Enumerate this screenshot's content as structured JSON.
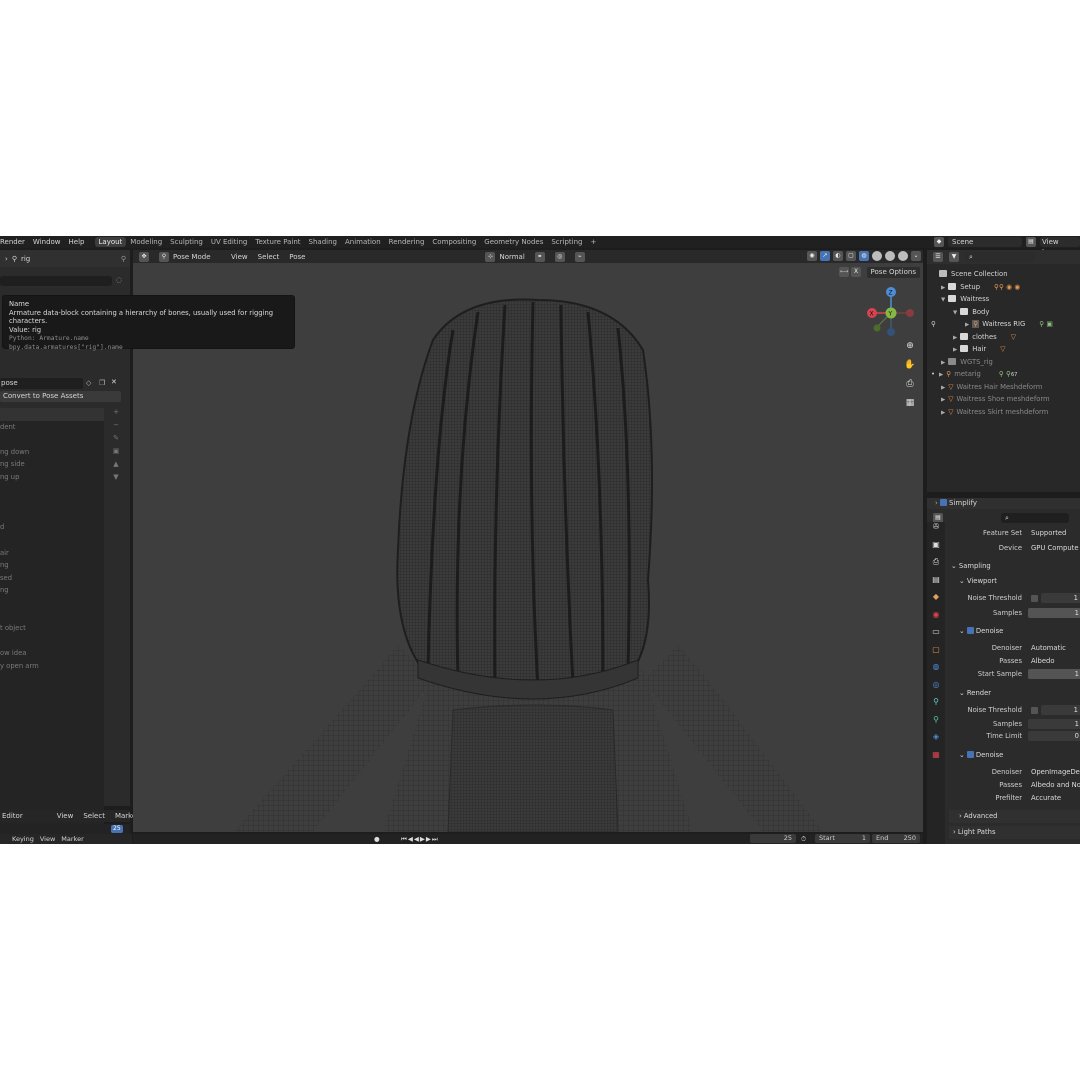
{
  "topbar": {
    "menus": [
      "Render",
      "Window",
      "Help"
    ],
    "workspaces": [
      {
        "label": "Layout",
        "active": true
      },
      {
        "label": "Modeling"
      },
      {
        "label": "Sculpting"
      },
      {
        "label": "UV Editing"
      },
      {
        "label": "Texture Paint"
      },
      {
        "label": "Shading"
      },
      {
        "label": "Animation"
      },
      {
        "label": "Rendering"
      },
      {
        "label": "Compositing"
      },
      {
        "label": "Geometry Nodes"
      },
      {
        "label": "Scripting"
      }
    ],
    "add_tab": "+",
    "scene": "Scene",
    "view_layer": "View Layer"
  },
  "left_panel": {
    "header_name": "rig",
    "pose_field": "pose",
    "convert_button": "Convert to Pose Assets",
    "list_items": [
      "",
      "dent",
      "",
      "ng down",
      "ng side",
      "ng up",
      "",
      "",
      "",
      "d",
      "",
      "air",
      "ng",
      "sed",
      "ng",
      "",
      "",
      "t object",
      "",
      "ow idea",
      "y open arm"
    ]
  },
  "tooltip": {
    "title": "Name",
    "description": "Armature data-block containing a hierarchy of bones, usually used for rigging characters.",
    "value": "Value: rig",
    "python1": "Python: Armature.name",
    "python2": "bpy.data.armatures[\"rig\"].name"
  },
  "timeline": {
    "editor_label": "Editor",
    "view": "View",
    "select": "Select",
    "marker": "Marker",
    "keying": "Keying",
    "view2": "View",
    "marker2": "Marker",
    "frame_badge": "25"
  },
  "viewport": {
    "mode": "Pose Mode",
    "menus": [
      "View",
      "Select",
      "Pose"
    ],
    "transform": "Normal",
    "pose_options": "Pose Options",
    "gizmo": {
      "z": "Z",
      "x": "X",
      "y": "Y"
    }
  },
  "playback": {
    "current_frame": "25",
    "start_label": "Start",
    "start": "1",
    "end_label": "End",
    "end": "250"
  },
  "outliner": {
    "rows": [
      {
        "label": "Scene Collection",
        "indent": 0,
        "type": "scene"
      },
      {
        "label": "Setup",
        "indent": 1,
        "type": "collection"
      },
      {
        "label": "Waitress",
        "indent": 1,
        "type": "collection",
        "expanded": true
      },
      {
        "label": "Body",
        "indent": 2,
        "type": "collection",
        "expanded": true
      },
      {
        "label": "Waitress RIG",
        "indent": 3,
        "type": "object",
        "selected": true
      },
      {
        "label": "clothes",
        "indent": 2,
        "type": "collection"
      },
      {
        "label": "Hair",
        "indent": 2,
        "type": "collection"
      },
      {
        "label": "WGTS_rig",
        "indent": 1,
        "type": "collection",
        "dim": true
      },
      {
        "label": "metarig",
        "indent": 1,
        "type": "object",
        "dim": true
      },
      {
        "label": "Waitres Hair Meshdeform",
        "indent": 1,
        "type": "mesh",
        "dim": true
      },
      {
        "label": "Waitress Shoe meshdeform",
        "indent": 1,
        "type": "mesh",
        "dim": true
      },
      {
        "label": "Waitress Skirt meshdeform",
        "indent": 1,
        "type": "mesh",
        "dim": true
      }
    ],
    "metarig_count": "67"
  },
  "properties": {
    "simplify": "Simplify",
    "feature_set_label": "Feature Set",
    "feature_set": "Supported",
    "device_label": "Device",
    "device": "GPU Compute",
    "sampling": "Sampling",
    "viewport_section": "Viewport",
    "noise_threshold_label": "Noise Threshold",
    "samples_label": "Samples",
    "denoise_label": "Denoise",
    "denoiser_label": "Denoiser",
    "vp_denoiser": "Automatic",
    "passes_label": "Passes",
    "vp_passes": "Albedo",
    "start_sample_label": "Start Sample",
    "render_section": "Render",
    "time_limit_label": "Time Limit",
    "r_denoiser": "OpenImageDen",
    "r_passes": "Albedo and Nor",
    "prefilter_label": "Prefilter",
    "prefilter": "Accurate",
    "advanced": "Advanced",
    "light_paths": "Light Paths",
    "val_1": "1",
    "val_0": "0"
  },
  "colors": {
    "accent": "#4772b3",
    "object_orange": "#e4944f",
    "bg_dark": "#1d1d1d",
    "viewport": "#3e3e3e"
  }
}
